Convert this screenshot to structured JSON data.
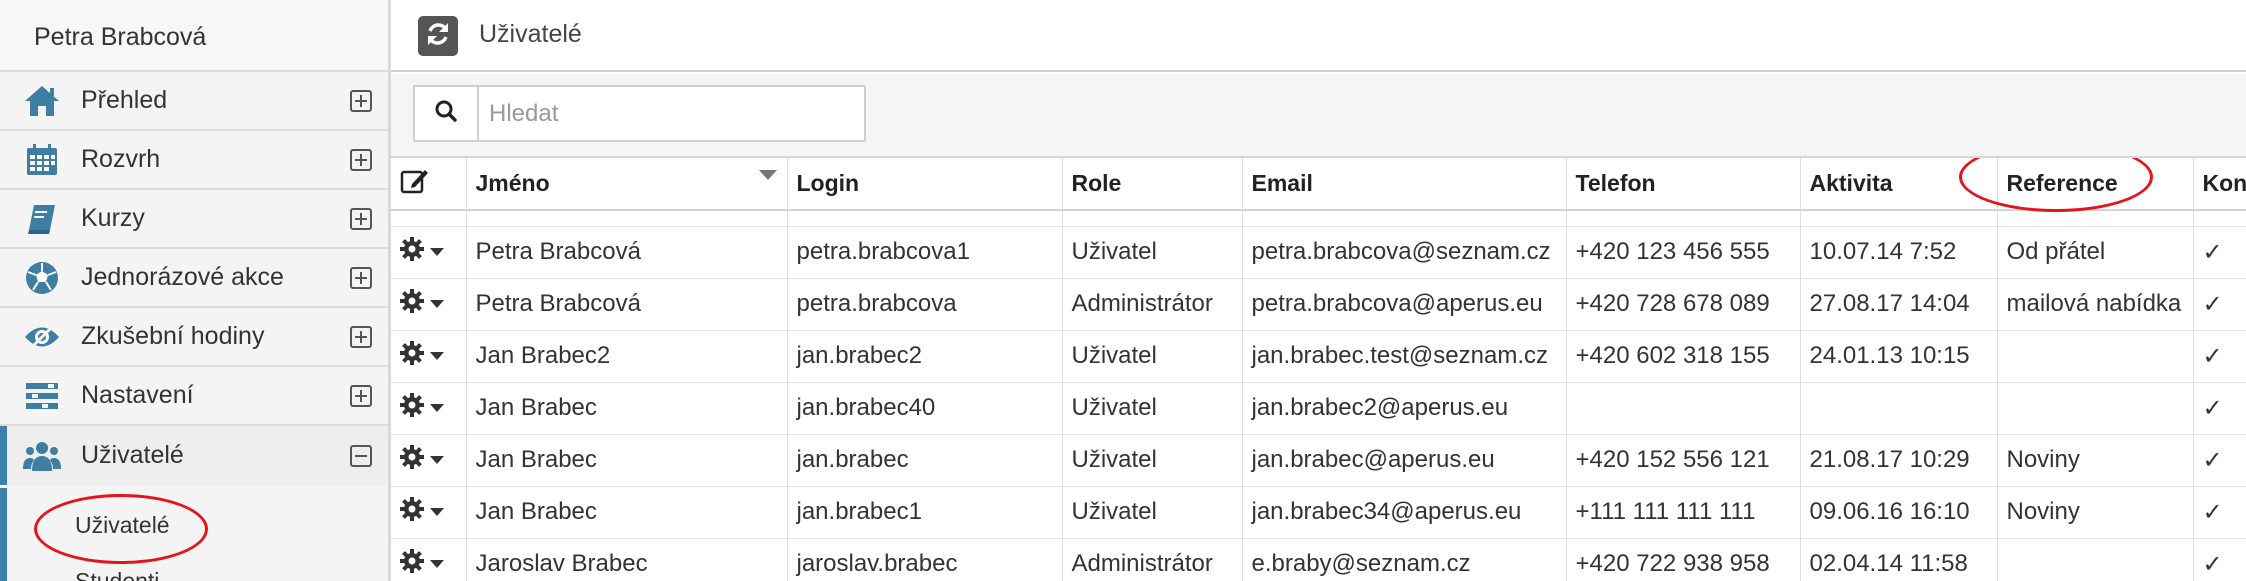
{
  "sidebar": {
    "user_name": "Petra Brabcová",
    "items": [
      {
        "label": "Přehled",
        "icon": "home-icon",
        "expanded": false
      },
      {
        "label": "Rozvrh",
        "icon": "calendar-icon",
        "expanded": false
      },
      {
        "label": "Kurzy",
        "icon": "book-icon",
        "expanded": false
      },
      {
        "label": "Jednorázové akce",
        "icon": "soccer-ball-icon",
        "expanded": false
      },
      {
        "label": "Zkušební hodiny",
        "icon": "eye-icon",
        "expanded": false
      },
      {
        "label": "Nastavení",
        "icon": "settings-icon",
        "expanded": false
      },
      {
        "label": "Uživatelé",
        "icon": "users-icon",
        "expanded": true
      }
    ],
    "subitems": [
      "Uživatelé",
      "Studenti"
    ]
  },
  "header": {
    "title": "Uživatelé",
    "refresh_icon": "refresh-icon"
  },
  "search": {
    "placeholder": "Hledat",
    "value": ""
  },
  "table": {
    "columns": [
      "Jméno",
      "Login",
      "Role",
      "Email",
      "Telefon",
      "Aktivita",
      "Reference",
      "Kontakt"
    ],
    "sorted_column": "Jméno",
    "rows": [
      {
        "name": "Petra Brabcová",
        "login": "petra.brabcova1",
        "role": "Uživatel",
        "email": "petra.brabcova@seznam.cz",
        "phone": "+420 123 456 555",
        "activity": "10.07.14 7:52",
        "reference": "Od přátel",
        "contact": "✓"
      },
      {
        "name": "Petra Brabcová",
        "login": "petra.brabcova",
        "role": "Administrátor",
        "email": "petra.brabcova@aperus.eu",
        "phone": "+420 728 678 089",
        "activity": "27.08.17 14:04",
        "reference": "mailová nabídka",
        "contact": "✓"
      },
      {
        "name": "Jan Brabec2",
        "login": "jan.brabec2",
        "role": "Uživatel",
        "email": "jan.brabec.test@seznam.cz",
        "phone": "+420 602 318 155",
        "activity": "24.01.13 10:15",
        "reference": "",
        "contact": "✓"
      },
      {
        "name": "Jan Brabec",
        "login": "jan.brabec40",
        "role": "Uživatel",
        "email": "jan.brabec2@aperus.eu",
        "phone": "",
        "activity": "",
        "reference": "",
        "contact": "✓"
      },
      {
        "name": "Jan Brabec",
        "login": "jan.brabec",
        "role": "Uživatel",
        "email": "jan.brabec@aperus.eu",
        "phone": "+420 152 556 121",
        "activity": "21.08.17 10:29",
        "reference": "Noviny",
        "contact": "✓"
      },
      {
        "name": "Jan Brabec",
        "login": "jan.brabec1",
        "role": "Uživatel",
        "email": "jan.brabec34@aperus.eu",
        "phone": "+111 111 111 111",
        "activity": "09.06.16 16:10",
        "reference": "Noviny",
        "contact": "✓"
      },
      {
        "name": "Jaroslav Brabec",
        "login": "jaroslav.brabec",
        "role": "Administrátor",
        "email": "e.braby@seznam.cz",
        "phone": "+420 722 938 958",
        "activity": "02.04.14 11:58",
        "reference": "",
        "contact": "✓"
      }
    ]
  },
  "colors": {
    "accent": "#3d7fa6",
    "annotation": "#e5141b",
    "icon": "#3f7ea3"
  }
}
